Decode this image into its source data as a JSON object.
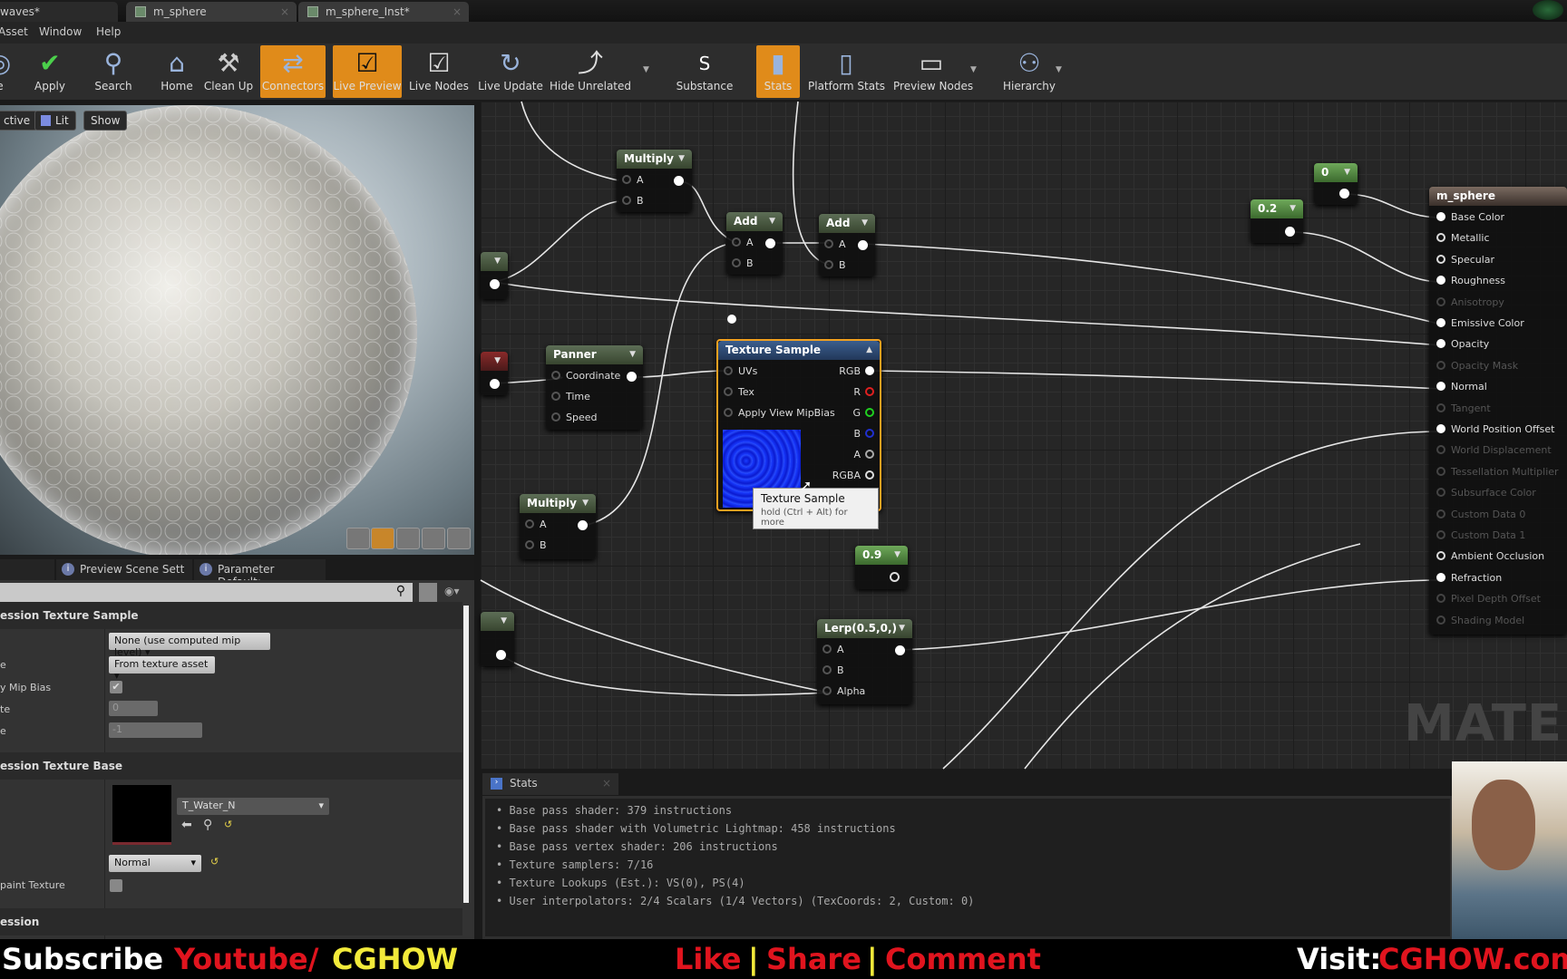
{
  "tabs": [
    {
      "label": "waves*"
    },
    {
      "label": "m_sphere"
    },
    {
      "label": "m_sphere_Inst*"
    }
  ],
  "menu": [
    "Asset",
    "Window",
    "Help"
  ],
  "toolbar": [
    {
      "label": "e",
      "icon": "save-icon"
    },
    {
      "label": "Apply",
      "icon": "checkmark-icon"
    },
    {
      "label": "Search",
      "icon": "binoculars-icon"
    },
    {
      "label": "Home",
      "icon": "house-icon"
    },
    {
      "label": "Clean Up",
      "icon": "broom-icon"
    },
    {
      "label": "Connectors",
      "icon": "connectors-icon",
      "active": true
    },
    {
      "label": "Live Preview",
      "icon": "tv-icon",
      "active": true
    },
    {
      "label": "Live Nodes",
      "icon": "live-nodes-icon"
    },
    {
      "label": "Live Update",
      "icon": "live-update-icon"
    },
    {
      "label": "Hide Unrelated",
      "icon": "hide-unrelated-icon"
    },
    {
      "label": "Substance",
      "icon": "substance-icon"
    },
    {
      "label": "Stats",
      "icon": "stats-icon",
      "active": true
    },
    {
      "label": "Platform Stats",
      "icon": "platform-stats-icon"
    },
    {
      "label": "Preview Nodes",
      "icon": "preview-nodes-icon"
    },
    {
      "label": "Hierarchy",
      "icon": "hierarchy-icon"
    }
  ],
  "viewport": {
    "buttons": [
      "ctive",
      "Lit",
      "Show"
    ]
  },
  "panel_tabs": [
    "Preview Scene Sett",
    "Parameter Default:"
  ],
  "details": {
    "section1": "ession Texture Sample",
    "mip_value_mode": "None (use computed mip level)",
    "label_e1": "e",
    "sampler_source": "From texture asset",
    "label_mipbias": "y Mip Bias",
    "mipbias_checked": true,
    "label_te": "te",
    "const_coordinate": "0",
    "label_e2": "e",
    "const_mip_value": "-1",
    "section2": "ession Texture Base",
    "texture": "T_Water_N",
    "sampler_type": "Normal",
    "label_paint": "paint Texture",
    "paint_checked": false,
    "section3": "ession"
  },
  "nodes": {
    "multiply1": {
      "title": "Multiply",
      "pins": [
        "A",
        "B"
      ]
    },
    "add1": {
      "title": "Add",
      "pins": [
        "A",
        "B"
      ]
    },
    "add2": {
      "title": "Add",
      "pins": [
        "A",
        "B"
      ]
    },
    "panner": {
      "title": "Panner",
      "pins": [
        "Coordinate",
        "Time",
        "Speed"
      ]
    },
    "texture_sample": {
      "title": "Texture Sample",
      "inputs": [
        "UVs",
        "Tex",
        "Apply View MipBias"
      ],
      "outputs": [
        "RGB",
        "R",
        "G",
        "B",
        "A",
        "RGBA"
      ]
    },
    "multiply2": {
      "title": "Multiply",
      "pins": [
        "A",
        "B"
      ]
    },
    "const09": {
      "title": "0.9"
    },
    "lerp": {
      "title": "Lerp(0.5,0,)",
      "pins": [
        "A",
        "B",
        "Alpha"
      ]
    },
    "const0": {
      "title": "0"
    },
    "const02": {
      "title": "0.2"
    },
    "material": {
      "title": "m_sphere",
      "pins": [
        {
          "label": "Base Color",
          "state": "connected"
        },
        {
          "label": "Metallic",
          "state": "open"
        },
        {
          "label": "Specular",
          "state": "open"
        },
        {
          "label": "Roughness",
          "state": "connected"
        },
        {
          "label": "Anisotropy",
          "state": "disabled"
        },
        {
          "label": "Emissive Color",
          "state": "connected"
        },
        {
          "label": "Opacity",
          "state": "connected"
        },
        {
          "label": "Opacity Mask",
          "state": "disabled"
        },
        {
          "label": "Normal",
          "state": "connected"
        },
        {
          "label": "Tangent",
          "state": "disabled"
        },
        {
          "label": "World Position Offset",
          "state": "connected"
        },
        {
          "label": "World Displacement",
          "state": "disabled"
        },
        {
          "label": "Tessellation Multiplier",
          "state": "disabled"
        },
        {
          "label": "Subsurface Color",
          "state": "disabled"
        },
        {
          "label": "Custom Data 0",
          "state": "disabled"
        },
        {
          "label": "Custom Data 1",
          "state": "disabled"
        },
        {
          "label": "Ambient Occlusion",
          "state": "open"
        },
        {
          "label": "Refraction",
          "state": "connected"
        },
        {
          "label": "Pixel Depth Offset",
          "state": "disabled"
        },
        {
          "label": "Shading Model",
          "state": "disabled"
        }
      ]
    }
  },
  "tooltip": {
    "title": "Texture Sample",
    "hint": "hold (Ctrl + Alt) for more"
  },
  "watermark": "MATER",
  "stats": {
    "tab": "Stats",
    "lines": [
      "Base pass shader: 379 instructions",
      "Base pass shader with Volumetric Lightmap: 458 instructions",
      "Base pass vertex shader: 206 instructions",
      "Texture samplers: 7/16",
      "Texture Lookups (Est.): VS(0), PS(4)",
      "User interpolators: 2/4 Scalars (1/4 Vectors) (TexCoords: 2, Custom: 0)"
    ]
  },
  "banner": {
    "subscribe": "Subscribe",
    "youtube": "Youtube/",
    "cghow": "CGHOW",
    "like": "Like",
    "share": "Share",
    "comment": "Comment",
    "sep": "|",
    "visit": "Visit:",
    "site": "CGHOW.com"
  },
  "colors": {
    "accent": "#e08b1a",
    "banner_red": "#e0141e",
    "banner_yellow": "#f2ea3a"
  }
}
